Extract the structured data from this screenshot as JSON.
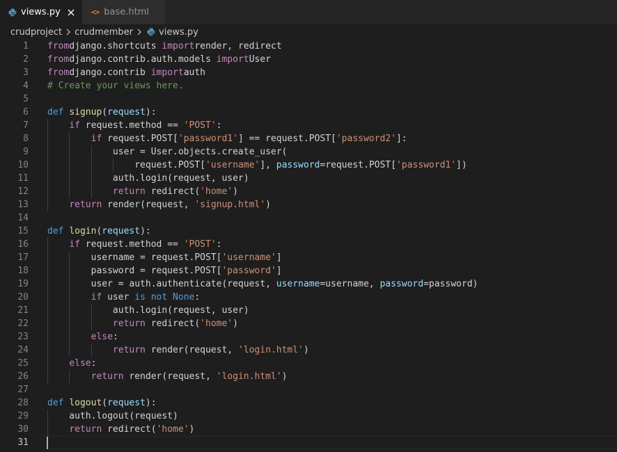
{
  "tabs": [
    {
      "label": "views.py",
      "icon": "python-icon",
      "active": true
    },
    {
      "label": "base.html",
      "icon": "html-icon",
      "active": false
    }
  ],
  "breadcrumb": [
    "crudproject",
    "crudmember",
    "views.py"
  ],
  "colors": {
    "editor_bg": "#1e1e1e",
    "tabbar_bg": "#252526",
    "keyword": "#c586c0",
    "def": "#569cd6",
    "function": "#dcdcaa",
    "string": "#ce9178",
    "comment": "#6a9955",
    "param": "#9cdcfe",
    "line_number": "#858585"
  },
  "cursor_line": 31,
  "lines": [
    [
      [
        "kw",
        "from"
      ],
      [
        "",
        "django.shortcuts "
      ],
      [
        "kw",
        "import"
      ],
      [
        "",
        "render, redirect"
      ]
    ],
    [
      [
        "kw",
        "from"
      ],
      [
        "",
        "django.contrib.auth.models "
      ],
      [
        "kw",
        "import"
      ],
      [
        "",
        "User"
      ]
    ],
    [
      [
        "kw",
        "from"
      ],
      [
        "",
        "django.contrib "
      ],
      [
        "kw",
        "import"
      ],
      [
        "",
        "auth"
      ]
    ],
    [
      [
        "cm",
        "# Create your views here."
      ]
    ],
    [],
    [
      [
        "def",
        "def"
      ],
      [
        "",
        " "
      ],
      [
        "fn",
        "signup"
      ],
      [
        "",
        "("
      ],
      [
        "prm",
        "request"
      ],
      [
        "",
        "):"
      ]
    ],
    [
      [
        "",
        "    "
      ],
      [
        "kw",
        "if"
      ],
      [
        "",
        " request.method == "
      ],
      [
        "str",
        "'POST'"
      ],
      [
        "",
        ":"
      ]
    ],
    [
      [
        "",
        "        "
      ],
      [
        "kw",
        "if"
      ],
      [
        "",
        " request.POST["
      ],
      [
        "str",
        "'password1'"
      ],
      [
        "",
        "] == request.POST["
      ],
      [
        "str",
        "'password2'"
      ],
      [
        "",
        "]:"
      ]
    ],
    [
      [
        "",
        "            user = User.objects.create_user("
      ]
    ],
    [
      [
        "",
        "                request.POST["
      ],
      [
        "str",
        "'username'"
      ],
      [
        "",
        "], "
      ],
      [
        "prm",
        "password"
      ],
      [
        "",
        "=request.POST["
      ],
      [
        "str",
        "'password1'"
      ],
      [
        "",
        "])"
      ]
    ],
    [
      [
        "",
        "            auth.login(request, user)"
      ]
    ],
    [
      [
        "",
        "            "
      ],
      [
        "kw",
        "return"
      ],
      [
        "",
        " redirect("
      ],
      [
        "str",
        "'home'"
      ],
      [
        "",
        ")"
      ]
    ],
    [
      [
        "",
        "    "
      ],
      [
        "kw",
        "return"
      ],
      [
        "",
        " render(request, "
      ],
      [
        "str",
        "'signup.html'"
      ],
      [
        "",
        ")"
      ]
    ],
    [],
    [
      [
        "def",
        "def"
      ],
      [
        "",
        " "
      ],
      [
        "fn",
        "login"
      ],
      [
        "",
        "("
      ],
      [
        "prm",
        "request"
      ],
      [
        "",
        "):"
      ]
    ],
    [
      [
        "",
        "    "
      ],
      [
        "kw",
        "if"
      ],
      [
        "",
        " request.method == "
      ],
      [
        "str",
        "'POST'"
      ],
      [
        "",
        ":"
      ]
    ],
    [
      [
        "",
        "        username = request.POST["
      ],
      [
        "str",
        "'username'"
      ],
      [
        "",
        "]"
      ]
    ],
    [
      [
        "",
        "        password = request.POST["
      ],
      [
        "str",
        "'password'"
      ],
      [
        "",
        "]"
      ]
    ],
    [
      [
        "",
        "        user = auth.authenticate(request, "
      ],
      [
        "prm",
        "username"
      ],
      [
        "",
        "=username, "
      ],
      [
        "prm",
        "password"
      ],
      [
        "",
        "=password)"
      ]
    ],
    [
      [
        "",
        "        "
      ],
      [
        "kw",
        "if"
      ],
      [
        "",
        " user "
      ],
      [
        "bi",
        "is not None"
      ],
      [
        "",
        ":"
      ]
    ],
    [
      [
        "",
        "            auth.login(request, user)"
      ]
    ],
    [
      [
        "",
        "            "
      ],
      [
        "kw",
        "return"
      ],
      [
        "",
        " redirect("
      ],
      [
        "str",
        "'home'"
      ],
      [
        "",
        ")"
      ]
    ],
    [
      [
        "",
        "        "
      ],
      [
        "kw",
        "else"
      ],
      [
        "",
        ":"
      ]
    ],
    [
      [
        "",
        "            "
      ],
      [
        "kw",
        "return"
      ],
      [
        "",
        " render(request, "
      ],
      [
        "str",
        "'login.html'"
      ],
      [
        "",
        ")"
      ]
    ],
    [
      [
        "",
        "    "
      ],
      [
        "kw",
        "else"
      ],
      [
        "",
        ":"
      ]
    ],
    [
      [
        "",
        "        "
      ],
      [
        "kw",
        "return"
      ],
      [
        "",
        " render(request, "
      ],
      [
        "str",
        "'login.html'"
      ],
      [
        "",
        ")"
      ]
    ],
    [],
    [
      [
        "def",
        "def"
      ],
      [
        "",
        " "
      ],
      [
        "fn",
        "logout"
      ],
      [
        "",
        "("
      ],
      [
        "prm",
        "request"
      ],
      [
        "",
        "):"
      ]
    ],
    [
      [
        "",
        "    auth.logout(request)"
      ]
    ],
    [
      [
        "",
        "    "
      ],
      [
        "kw",
        "return"
      ],
      [
        "",
        " redirect("
      ],
      [
        "str",
        "'home'"
      ],
      [
        "",
        ")"
      ]
    ],
    []
  ]
}
